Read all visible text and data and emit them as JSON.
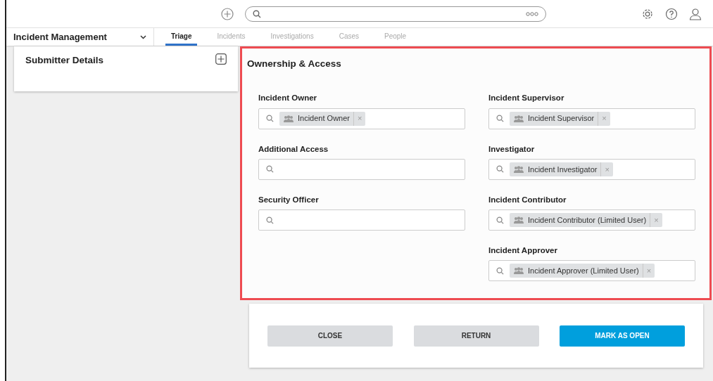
{
  "app": {
    "module": "Incident Management"
  },
  "tabs": [
    {
      "label": "Triage",
      "selected": true
    },
    {
      "label": "Incidents",
      "selected": false
    },
    {
      "label": "Investigations",
      "selected": false
    },
    {
      "label": "Cases",
      "selected": false
    },
    {
      "label": "People",
      "selected": false
    }
  ],
  "submitter_panel": {
    "title": "Submitter Details"
  },
  "ownership_panel": {
    "title": "Ownership & Access",
    "left_fields": [
      {
        "label": "Incident Owner",
        "tags": [
          {
            "label": "Incident Owner",
            "remove": "×"
          }
        ]
      },
      {
        "label": "Additional Access"
      },
      {
        "label": "Security Officer"
      }
    ],
    "right_fields": [
      {
        "label": "Incident Supervisor",
        "tags": [
          {
            "label": "Incident Supervisor",
            "remove": "×"
          }
        ]
      },
      {
        "label": "Investigator",
        "tags": [
          {
            "label": "Incident Investigator",
            "remove": "×"
          }
        ]
      },
      {
        "label": "Incident Contributor",
        "tags": [
          {
            "label": "Incident Contributor (Limited User)",
            "remove": "×"
          }
        ]
      },
      {
        "label": "Incident Approver",
        "tags": [
          {
            "label": "Incident Approver (Limited User)",
            "remove": "×"
          }
        ]
      }
    ]
  },
  "buttons": [
    {
      "label": "CLOSE",
      "kind": "secondary"
    },
    {
      "label": "RETURN",
      "kind": "secondary"
    },
    {
      "label": "MARK AS OPEN",
      "kind": "primary"
    }
  ]
}
